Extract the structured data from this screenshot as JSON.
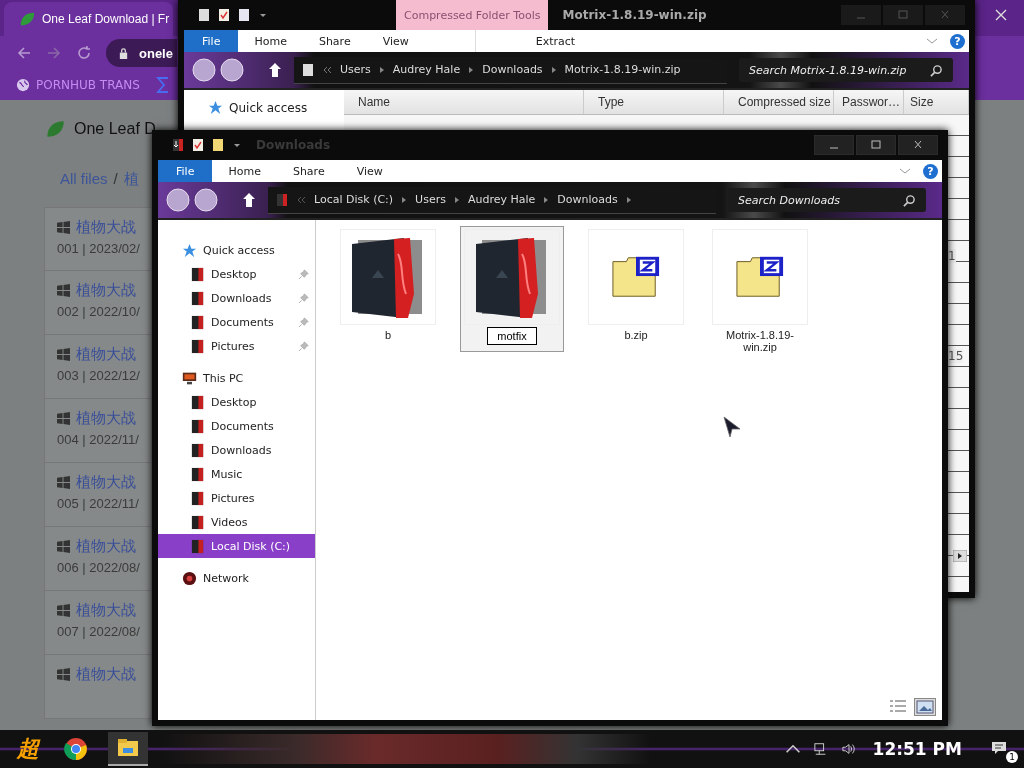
{
  "browser": {
    "tab_title": "One Leaf Download | Fr",
    "url": "onele",
    "bookmarks": [
      {
        "label": "PORNHUB TRANS"
      }
    ],
    "page": {
      "site_title": "One Leaf D",
      "breadcrumb": {
        "separator": "/",
        "items": [
          "All files",
          "植"
        ]
      },
      "items": [
        {
          "title": "植物大战",
          "meta": "001 | 2023/02/"
        },
        {
          "title": "植物大战",
          "meta": "002 | 2022/10/"
        },
        {
          "title": "植物大战",
          "meta": "003 | 2022/12/"
        },
        {
          "title": "植物大战",
          "meta": "004 | 2022/11/"
        },
        {
          "title": "植物大战",
          "meta": "005 | 2022/11/"
        },
        {
          "title": "植物大战",
          "meta": "006 | 2022/08/"
        },
        {
          "title": "植物大战",
          "meta": "007 | 2022/08/"
        },
        {
          "title": "植物大战"
        }
      ]
    }
  },
  "zip_window": {
    "context_tab": "Compressed Folder Tools",
    "title": "Motrix-1.8.19-win.zip",
    "ribbon": [
      {
        "label": "File",
        "kind": "menu"
      },
      {
        "label": "Home",
        "kind": "tab"
      },
      {
        "label": "Share",
        "kind": "tab"
      },
      {
        "label": "View",
        "kind": "tab"
      },
      {
        "label": "Extract",
        "kind": "context"
      }
    ],
    "help": "?",
    "address": [
      "Users",
      "Audrey Hale",
      "Downloads",
      "Motrix-1.8.19-win.zip"
    ],
    "search": {
      "placeholder": "Search Motrix-1.8.19-win.zip"
    },
    "nav": [
      {
        "label": "Quick access"
      }
    ],
    "columns": [
      "Name",
      "Type",
      "Compressed size",
      "Passwor…",
      "Size"
    ],
    "rows": [
      {
        "size": "1"
      },
      {
        "size": "15"
      }
    ]
  },
  "downloads_window": {
    "title": "Downloads",
    "ribbon": [
      {
        "label": "File",
        "kind": "menu"
      },
      {
        "label": "Home",
        "kind": "tab"
      },
      {
        "label": "Share",
        "kind": "tab"
      },
      {
        "label": "View",
        "kind": "tab"
      }
    ],
    "help": "?",
    "address": [
      "Local Disk (C:)",
      "Users",
      "Audrey Hale",
      "Downloads"
    ],
    "search": {
      "placeholder": "Search Downloads"
    },
    "nav": [
      {
        "label": "Quick access",
        "selected": false,
        "children": [
          {
            "label": "Desktop",
            "pinned": true,
            "selected": false
          },
          {
            "label": "Downloads",
            "pinned": true,
            "selected": false
          },
          {
            "label": "Documents",
            "pinned": true,
            "selected": false
          },
          {
            "label": "Pictures",
            "pinned": true,
            "selected": false
          }
        ]
      },
      {
        "label": "This PC",
        "selected": false,
        "children": [
          {
            "label": "Desktop",
            "pinned": false,
            "selected": false
          },
          {
            "label": "Documents",
            "pinned": false,
            "selected": false
          },
          {
            "label": "Downloads",
            "pinned": false,
            "selected": false
          },
          {
            "label": "Music",
            "pinned": false,
            "selected": false
          },
          {
            "label": "Pictures",
            "pinned": false,
            "selected": false
          },
          {
            "label": "Videos",
            "pinned": false,
            "selected": false
          },
          {
            "label": "Local Disk (C:)",
            "pinned": false,
            "selected": true
          }
        ]
      },
      {
        "label": "Network",
        "selected": false
      }
    ],
    "files": [
      {
        "name": "b",
        "kind": "folder",
        "selected": false,
        "renaming": false
      },
      {
        "name": "motfix",
        "kind": "folder",
        "selected": true,
        "renaming": true
      },
      {
        "name": "b.zip",
        "kind": "zip",
        "selected": false,
        "renaming": false
      },
      {
        "name": "Motrix-1.8.19-win.zip",
        "kind": "zip",
        "selected": false,
        "renaming": false
      }
    ]
  },
  "taskbar": {
    "start_glyph": "超",
    "time": "12:51 PM",
    "notifications": "1"
  }
}
